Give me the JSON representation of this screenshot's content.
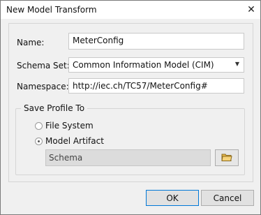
{
  "window": {
    "title": "New Model Transform",
    "close_glyph": "✕"
  },
  "form": {
    "name_label": "Name:",
    "name_value": "MeterConfig",
    "schema_set_label": "Schema Set:",
    "schema_set_value": "Common Information Model (CIM)",
    "namespace_label": "Namespace:",
    "namespace_value": "http://iec.ch/TC57/MeterConfig#"
  },
  "save_profile": {
    "group_label": "Save Profile To",
    "options": [
      {
        "label": "File System",
        "selected": false
      },
      {
        "label": "Model Artifact",
        "selected": true
      }
    ],
    "artifact_value": "Schema",
    "browse_icon": "folder-open-icon"
  },
  "buttons": {
    "ok": "OK",
    "cancel": "Cancel"
  }
}
